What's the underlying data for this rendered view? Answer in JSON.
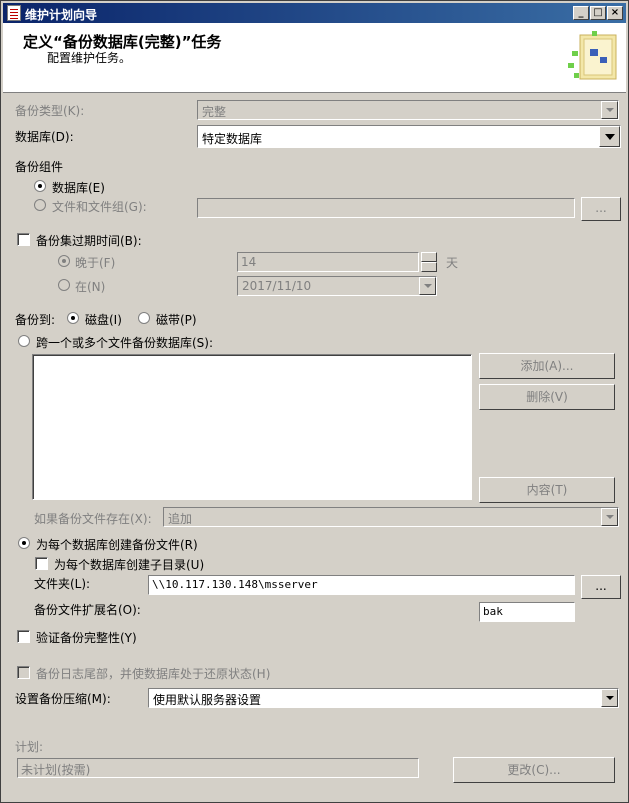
{
  "window": {
    "title": "维护计划向导"
  },
  "header": {
    "title": "定义“备份数据库(完整)”任务",
    "subtitle": "配置维护任务。"
  },
  "backup_type": {
    "label": "备份类型(K):",
    "value": "完整"
  },
  "database": {
    "label": "数据库(D):",
    "value": "特定数据库"
  },
  "backup_component": {
    "label": "备份组件",
    "database_option": "数据库(E)",
    "files_option": "文件和文件组(G):",
    "browse": "..."
  },
  "expire": {
    "label": "备份集过期时间(B):",
    "after_label": "晚于(F)",
    "after_value": "14",
    "unit": "天",
    "on_label": "在(N)",
    "on_value": "2017/11/10"
  },
  "backup_to": {
    "label": "备份到:",
    "disk": "磁盘(I)",
    "tape": "磁带(P)"
  },
  "span": {
    "label": "跨一个或多个文件备份数据库(S):",
    "add": "添加(A)...",
    "remove": "删除(V)",
    "contents": "内容(T)",
    "if_exists_label": "如果备份文件存在(X):",
    "if_exists_value": "追加"
  },
  "per_db": {
    "label": "为每个数据库创建备份文件(R)",
    "subdir": "为每个数据库创建子目录(U)",
    "folder_label": "文件夹(L):",
    "folder_value": "\\\\10.117.130.148\\msserver",
    "browse": "...",
    "ext_label": "备份文件扩展名(O):",
    "ext_value": "bak"
  },
  "verify": {
    "label": "验证备份完整性(Y)"
  },
  "tail_log": {
    "label": "备份日志尾部，并使数据库处于还原状态(H)"
  },
  "compression": {
    "label": "设置备份压缩(M):",
    "value": "使用默认服务器设置"
  },
  "schedule": {
    "label": "计划:",
    "value": "未计划(按需)",
    "change": "更改(C)..."
  }
}
